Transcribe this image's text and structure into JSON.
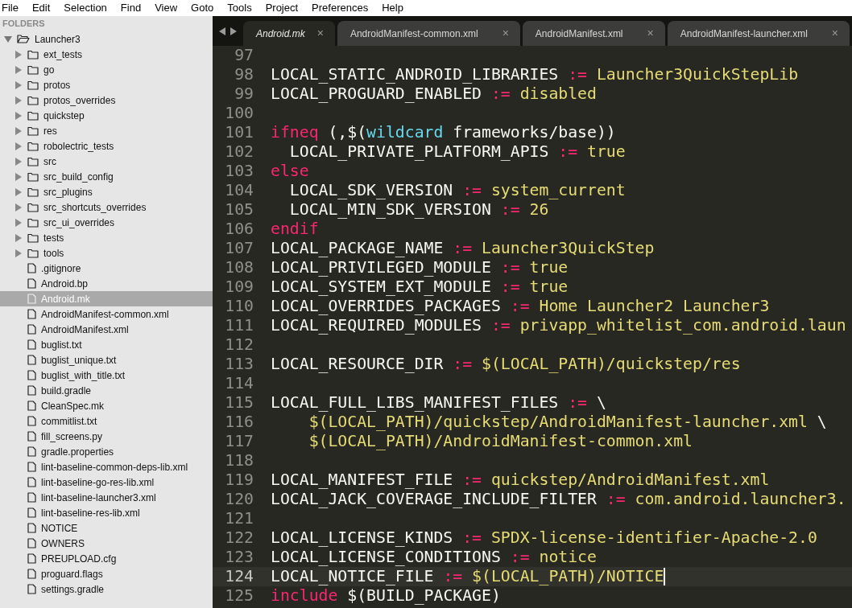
{
  "menu": [
    "File",
    "Edit",
    "Selection",
    "Find",
    "View",
    "Goto",
    "Tools",
    "Project",
    "Preferences",
    "Help"
  ],
  "sidebar": {
    "header": "FOLDERS",
    "tree": [
      {
        "kind": "folder",
        "label": "Launcher3",
        "expanded": true,
        "selected": false,
        "children": [
          {
            "kind": "folder",
            "label": "ext_tests",
            "expanded": false,
            "selected": false
          },
          {
            "kind": "folder",
            "label": "go",
            "expanded": false,
            "selected": false
          },
          {
            "kind": "folder",
            "label": "protos",
            "expanded": false,
            "selected": false
          },
          {
            "kind": "folder",
            "label": "protos_overrides",
            "expanded": false,
            "selected": false
          },
          {
            "kind": "folder",
            "label": "quickstep",
            "expanded": false,
            "selected": false
          },
          {
            "kind": "folder",
            "label": "res",
            "expanded": false,
            "selected": false
          },
          {
            "kind": "folder",
            "label": "robolectric_tests",
            "expanded": false,
            "selected": false
          },
          {
            "kind": "folder",
            "label": "src",
            "expanded": false,
            "selected": false
          },
          {
            "kind": "folder",
            "label": "src_build_config",
            "expanded": false,
            "selected": false
          },
          {
            "kind": "folder",
            "label": "src_plugins",
            "expanded": false,
            "selected": false
          },
          {
            "kind": "folder",
            "label": "src_shortcuts_overrides",
            "expanded": false,
            "selected": false
          },
          {
            "kind": "folder",
            "label": "src_ui_overrides",
            "expanded": false,
            "selected": false
          },
          {
            "kind": "folder",
            "label": "tests",
            "expanded": false,
            "selected": false
          },
          {
            "kind": "folder",
            "label": "tools",
            "expanded": false,
            "selected": false
          },
          {
            "kind": "file",
            "label": ".gitignore",
            "selected": false
          },
          {
            "kind": "file",
            "label": "Android.bp",
            "selected": false
          },
          {
            "kind": "file",
            "label": "Android.mk",
            "selected": true
          },
          {
            "kind": "file",
            "label": "AndroidManifest-common.xml",
            "selected": false
          },
          {
            "kind": "file",
            "label": "AndroidManifest.xml",
            "selected": false
          },
          {
            "kind": "file",
            "label": "buglist.txt",
            "selected": false
          },
          {
            "kind": "file",
            "label": "buglist_unique.txt",
            "selected": false
          },
          {
            "kind": "file",
            "label": "buglist_with_title.txt",
            "selected": false
          },
          {
            "kind": "file",
            "label": "build.gradle",
            "selected": false
          },
          {
            "kind": "file",
            "label": "CleanSpec.mk",
            "selected": false
          },
          {
            "kind": "file",
            "label": "commitlist.txt",
            "selected": false
          },
          {
            "kind": "file",
            "label": "fill_screens.py",
            "selected": false
          },
          {
            "kind": "file",
            "label": "gradle.properties",
            "selected": false
          },
          {
            "kind": "file",
            "label": "lint-baseline-common-deps-lib.xml",
            "selected": false
          },
          {
            "kind": "file",
            "label": "lint-baseline-go-res-lib.xml",
            "selected": false
          },
          {
            "kind": "file",
            "label": "lint-baseline-launcher3.xml",
            "selected": false
          },
          {
            "kind": "file",
            "label": "lint-baseline-res-lib.xml",
            "selected": false
          },
          {
            "kind": "file",
            "label": "NOTICE",
            "selected": false
          },
          {
            "kind": "file",
            "label": "OWNERS",
            "selected": false
          },
          {
            "kind": "file",
            "label": "PREUPLOAD.cfg",
            "selected": false
          },
          {
            "kind": "file",
            "label": "proguard.flags",
            "selected": false
          },
          {
            "kind": "file",
            "label": "settings.gradle",
            "selected": false
          }
        ]
      }
    ]
  },
  "tabs": [
    {
      "label": "Android.mk",
      "selected": true,
      "close": "×"
    },
    {
      "label": "AndroidManifest-common.xml",
      "selected": false,
      "close": "×"
    },
    {
      "label": "AndroidManifest.xml",
      "selected": false,
      "close": "×"
    },
    {
      "label": "AndroidManifest-launcher.xml",
      "selected": false,
      "close": "×"
    }
  ],
  "editor": {
    "lines": [
      {
        "number": "97",
        "current": false
      },
      {
        "number": "98",
        "current": false,
        "tokens": [
          {
            "kind": "plain",
            "text": "LOCAL_STATIC_ANDROID_LIBRARIES "
          },
          {
            "kind": "op",
            "text": ":="
          },
          {
            "kind": "value",
            "text": " Launcher3QuickStepLib"
          }
        ]
      },
      {
        "number": "99",
        "current": false,
        "tokens": [
          {
            "kind": "plain",
            "text": "LOCAL_PROGUARD_ENABLED "
          },
          {
            "kind": "op",
            "text": ":="
          },
          {
            "kind": "value",
            "text": " disabled"
          }
        ]
      },
      {
        "number": "100",
        "current": false
      },
      {
        "number": "101",
        "current": false,
        "tokens": [
          {
            "kind": "keyword",
            "text": "ifneq"
          },
          {
            "kind": "plain",
            "text": " (,$("
          },
          {
            "kind": "function",
            "text": "wildcard"
          },
          {
            "kind": "plain",
            "text": " frameworks/base))"
          }
        ]
      },
      {
        "number": "102",
        "current": false,
        "tokens": [
          {
            "kind": "plain",
            "text": "  LOCAL_PRIVATE_PLATFORM_APIS "
          },
          {
            "kind": "op",
            "text": ":="
          },
          {
            "kind": "value",
            "text": " true"
          }
        ]
      },
      {
        "number": "103",
        "current": false,
        "tokens": [
          {
            "kind": "keyword",
            "text": "else"
          }
        ]
      },
      {
        "number": "104",
        "current": false,
        "tokens": [
          {
            "kind": "plain",
            "text": "  LOCAL_SDK_VERSION "
          },
          {
            "kind": "op",
            "text": ":="
          },
          {
            "kind": "value",
            "text": " system_current"
          }
        ]
      },
      {
        "number": "105",
        "current": false,
        "tokens": [
          {
            "kind": "plain",
            "text": "  LOCAL_MIN_SDK_VERSION "
          },
          {
            "kind": "op",
            "text": ":="
          },
          {
            "kind": "value",
            "text": " 26"
          }
        ]
      },
      {
        "number": "106",
        "current": false,
        "tokens": [
          {
            "kind": "keyword",
            "text": "endif"
          }
        ]
      },
      {
        "number": "107",
        "current": false,
        "tokens": [
          {
            "kind": "plain",
            "text": "LOCAL_PACKAGE_NAME "
          },
          {
            "kind": "op",
            "text": ":="
          },
          {
            "kind": "value",
            "text": " Launcher3QuickStep"
          }
        ]
      },
      {
        "number": "108",
        "current": false,
        "tokens": [
          {
            "kind": "plain",
            "text": "LOCAL_PRIVILEGED_MODULE "
          },
          {
            "kind": "op",
            "text": ":="
          },
          {
            "kind": "value",
            "text": " true"
          }
        ]
      },
      {
        "number": "109",
        "current": false,
        "tokens": [
          {
            "kind": "plain",
            "text": "LOCAL_SYSTEM_EXT_MODULE "
          },
          {
            "kind": "op",
            "text": ":="
          },
          {
            "kind": "value",
            "text": " true"
          }
        ]
      },
      {
        "number": "110",
        "current": false,
        "tokens": [
          {
            "kind": "plain",
            "text": "LOCAL_OVERRIDES_PACKAGES "
          },
          {
            "kind": "op",
            "text": ":="
          },
          {
            "kind": "value",
            "text": " Home Launcher2 Launcher3"
          }
        ]
      },
      {
        "number": "111",
        "current": false,
        "tokens": [
          {
            "kind": "plain",
            "text": "LOCAL_REQUIRED_MODULES "
          },
          {
            "kind": "op",
            "text": ":="
          },
          {
            "kind": "value",
            "text": " privapp_whitelist_com.android.laun"
          }
        ]
      },
      {
        "number": "112",
        "current": false
      },
      {
        "number": "113",
        "current": false,
        "tokens": [
          {
            "kind": "plain",
            "text": "LOCAL_RESOURCE_DIR "
          },
          {
            "kind": "op",
            "text": ":="
          },
          {
            "kind": "value",
            "text": " $(LOCAL_PATH)/quickstep/res"
          }
        ]
      },
      {
        "number": "114",
        "current": false
      },
      {
        "number": "115",
        "current": false,
        "tokens": [
          {
            "kind": "plain",
            "text": "LOCAL_FULL_LIBS_MANIFEST_FILES "
          },
          {
            "kind": "op",
            "text": ":="
          },
          {
            "kind": "plain",
            "text": " \\"
          }
        ]
      },
      {
        "number": "116",
        "current": false,
        "tokens": [
          {
            "kind": "value",
            "text": "    $(LOCAL_PATH)/quickstep/AndroidManifest-launcher.xml"
          },
          {
            "kind": "plain",
            "text": " \\"
          }
        ]
      },
      {
        "number": "117",
        "current": false,
        "tokens": [
          {
            "kind": "value",
            "text": "    $(LOCAL_PATH)/AndroidManifest-common.xml"
          }
        ]
      },
      {
        "number": "118",
        "current": false
      },
      {
        "number": "119",
        "current": false,
        "tokens": [
          {
            "kind": "plain",
            "text": "LOCAL_MANIFEST_FILE "
          },
          {
            "kind": "op",
            "text": ":="
          },
          {
            "kind": "value",
            "text": " quickstep/AndroidManifest.xml"
          }
        ]
      },
      {
        "number": "120",
        "current": false,
        "tokens": [
          {
            "kind": "plain",
            "text": "LOCAL_JACK_COVERAGE_INCLUDE_FILTER "
          },
          {
            "kind": "op",
            "text": ":="
          },
          {
            "kind": "value",
            "text": " com.android.launcher3."
          }
        ]
      },
      {
        "number": "121",
        "current": false
      },
      {
        "number": "122",
        "current": false,
        "tokens": [
          {
            "kind": "plain",
            "text": "LOCAL_LICENSE_KINDS "
          },
          {
            "kind": "op",
            "text": ":="
          },
          {
            "kind": "value",
            "text": " SPDX-license-identifier-Apache-2.0"
          }
        ]
      },
      {
        "number": "123",
        "current": false,
        "tokens": [
          {
            "kind": "plain",
            "text": "LOCAL_LICENSE_CONDITIONS "
          },
          {
            "kind": "op",
            "text": ":="
          },
          {
            "kind": "value",
            "text": " notice"
          }
        ]
      },
      {
        "number": "124",
        "current": true,
        "tokens": [
          {
            "kind": "plain",
            "text": "LOCAL_NOTICE_FILE "
          },
          {
            "kind": "op",
            "text": ":="
          },
          {
            "kind": "value",
            "text": " $(LOCAL_PATH)/NOTICE"
          }
        ]
      },
      {
        "number": "125",
        "current": false,
        "tokens": [
          {
            "kind": "keyword",
            "text": "include"
          },
          {
            "kind": "plain",
            "text": " $(BUILD_PACKAGE)"
          }
        ]
      }
    ]
  }
}
